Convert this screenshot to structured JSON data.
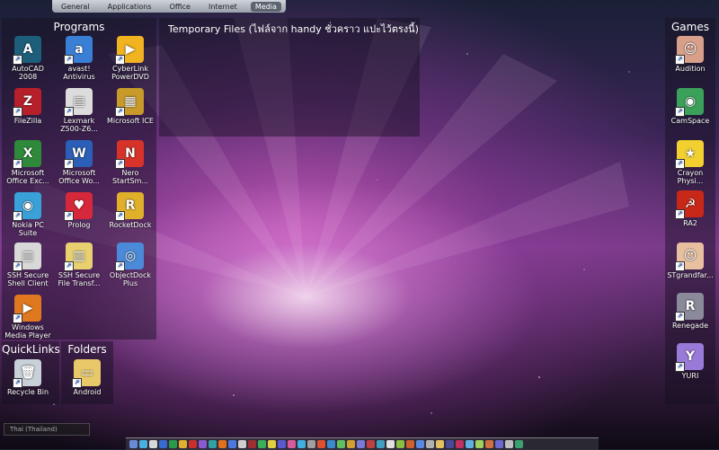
{
  "tabs": [
    "General",
    "Applications",
    "Office",
    "Internet",
    "Media"
  ],
  "panels": {
    "programs_title": "Programs",
    "temp_title": "Temporary Files (ไฟล์จาก handy ชั่วคราว แปะไว้ตรงนี้)",
    "games_title": "Games",
    "quicklinks_title": "QuickLinks",
    "folders_title": "Folders"
  },
  "programs": [
    {
      "label": "AutoCAD 2008",
      "icon": "autocad-icon",
      "color": "#1d5f7a",
      "glyph": "A"
    },
    {
      "label": "avast! Antivirus",
      "icon": "avast-icon",
      "color": "#3a7fd6",
      "glyph": "a"
    },
    {
      "label": "CyberLink PowerDVD",
      "icon": "powerdvd-icon",
      "color": "#f2b321",
      "glyph": "▶"
    },
    {
      "label": "FileZilla",
      "icon": "filezilla-icon",
      "color": "#b7202a",
      "glyph": "Z"
    },
    {
      "label": "Lexmark Z500-Z6...",
      "icon": "printer-icon",
      "color": "#dcdcdc",
      "glyph": "▤"
    },
    {
      "label": "Microsoft ICE",
      "icon": "ice-icon",
      "color": "#c79a2a",
      "glyph": "▦"
    },
    {
      "label": "Microsoft Office Exc...",
      "icon": "excel-icon",
      "color": "#2e8a3a",
      "glyph": "X"
    },
    {
      "label": "Microsoft Office Wo...",
      "icon": "word-icon",
      "color": "#2b5fb8",
      "glyph": "W"
    },
    {
      "label": "Nero StartSm...",
      "icon": "nero-icon",
      "color": "#d83328",
      "glyph": "N"
    },
    {
      "label": "Nokia PC Suite",
      "icon": "nokia-icon",
      "color": "#3aa0d8",
      "glyph": "◉"
    },
    {
      "label": "Prolog",
      "icon": "prolog-icon",
      "color": "#d6283a",
      "glyph": "♥"
    },
    {
      "label": "RocketDock",
      "icon": "rocketdock-icon",
      "color": "#e0b02a",
      "glyph": "R"
    },
    {
      "label": "SSH Secure Shell Client",
      "icon": "ssh-client-icon",
      "color": "#d8d8d8",
      "glyph": "▥"
    },
    {
      "label": "SSH Secure File Transf...",
      "icon": "ssh-transfer-icon",
      "color": "#e8d070",
      "glyph": "▥"
    },
    {
      "label": "ObjectDock Plus",
      "icon": "objectdock-icon",
      "color": "#4a8ad8",
      "glyph": "◎"
    },
    {
      "label": "Windows Media Player",
      "icon": "media-player-icon",
      "color": "#e07820",
      "glyph": "▶"
    }
  ],
  "games": [
    {
      "label": "Audition",
      "icon": "audition-icon",
      "color": "#d8a08a",
      "glyph": "☺"
    },
    {
      "label": "CamSpace",
      "icon": "camspace-icon",
      "color": "#3aa05a",
      "glyph": "◉"
    },
    {
      "label": "Crayon Physi...",
      "icon": "crayon-physics-icon",
      "color": "#f2d030",
      "glyph": "★"
    },
    {
      "label": "RA2",
      "icon": "ra2-icon",
      "color": "#c82818",
      "glyph": "☭"
    },
    {
      "label": "STgrandfar...",
      "icon": "stgrandfar-icon",
      "color": "#e8c0a0",
      "glyph": "☺"
    },
    {
      "label": "Renegade",
      "icon": "renegade-icon",
      "color": "#8a8a9a",
      "glyph": "R"
    },
    {
      "label": "YURI",
      "icon": "yuri-icon",
      "color": "#9a7ad8",
      "glyph": "Y"
    }
  ],
  "quicklinks": [
    {
      "label": "Recycle Bin",
      "icon": "recycle-bin-icon",
      "color": "#c8d0d8",
      "glyph": "🗑"
    }
  ],
  "folders": [
    {
      "label": "Android",
      "icon": "folder-icon",
      "color": "#e8c868",
      "glyph": "▭"
    }
  ],
  "language": "Thai (Thailand)"
}
